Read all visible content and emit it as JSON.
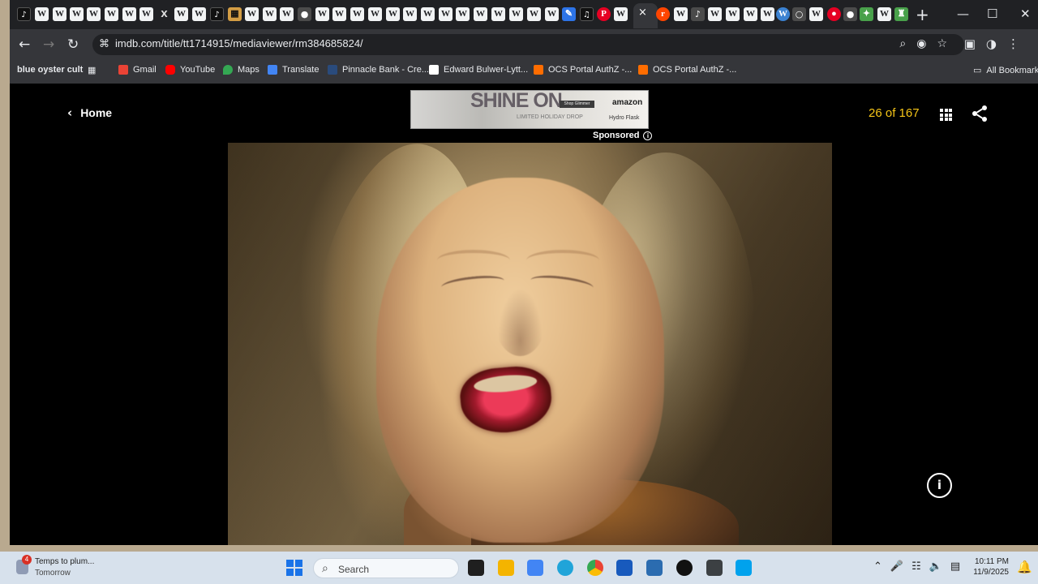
{
  "browser": {
    "url": "imdb.com/title/tt1714915/mediaviewer/rm384685824/",
    "new_tab": "+",
    "close_tab": "×",
    "window_minimize": "—",
    "window_maximize": "☐",
    "window_close": "✕",
    "tabs": [
      "TikTok",
      "W",
      "W",
      "W",
      "W",
      "W",
      "W",
      "W",
      "X",
      "W",
      "W",
      "TikTok",
      "Image",
      "W",
      "W",
      "Web",
      "W",
      "W",
      "W",
      "W",
      "W",
      "W",
      "W",
      "W",
      "W",
      "W",
      "W",
      "W",
      "Pinterest",
      "W",
      "close",
      "Reddit",
      "Audio",
      "W",
      "W",
      "W",
      "W",
      "WordPress",
      "Circle",
      "W",
      "Red",
      "Web",
      "Star",
      "W",
      "Shield"
    ],
    "bookmarks": [
      {
        "label": "blue oyster cult",
        "color": "#202124"
      },
      {
        "label": "Gmail",
        "color": "#ea4335"
      },
      {
        "label": "YouTube",
        "color": "#ff0000"
      },
      {
        "label": "Maps",
        "color": "#34a853"
      },
      {
        "label": "Translate",
        "color": "#4285f4"
      },
      {
        "label": "Pinnacle Bank - Cre...",
        "color": "#2a4b7c"
      },
      {
        "label": "Edward Bulwer-Lytt...",
        "color": "#ffffff"
      },
      {
        "label": "OCS Portal AuthZ -...",
        "color": "#ff6d00"
      },
      {
        "label": "OCS Portal AuthZ -...",
        "color": "#ff6d00"
      },
      {
        "label": "All Bookmarks",
        "color": "#e8eaed"
      }
    ]
  },
  "imdb": {
    "home": "Home",
    "sponsored": "Sponsored",
    "counter": "26 of 167",
    "ad": {
      "title": "SHINE ON",
      "subtitle": "LIMITED HOLIDAY DROP",
      "shop": "Shop Glimmer",
      "brand": "amazon",
      "hydro": "Hydro Flask"
    },
    "info_icon": "i"
  },
  "taskbar": {
    "notification_count": "4",
    "notification_title": "Temps to plum...",
    "notification_subtitle": "Tomorrow",
    "search_placeholder": "Search",
    "time": "10:11 PM",
    "date": "11/9/2025"
  }
}
